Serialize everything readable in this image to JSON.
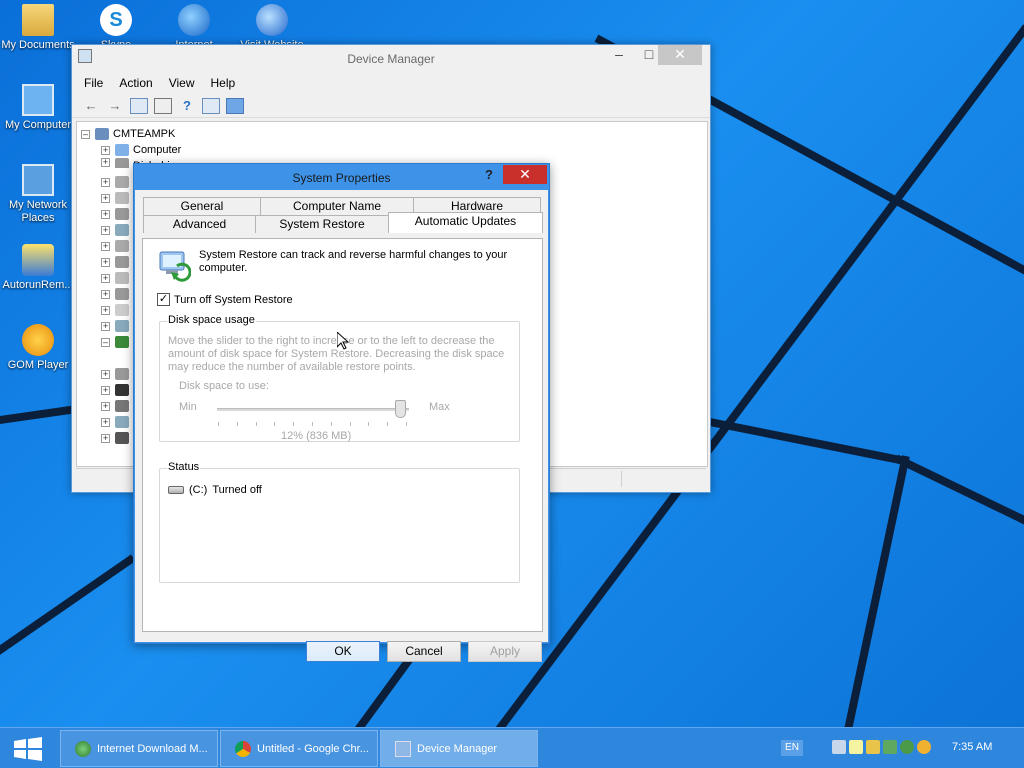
{
  "desktop": {
    "icons": [
      {
        "label": "My Documents"
      },
      {
        "label": "Skype"
      },
      {
        "label": "Internet"
      },
      {
        "label": "Visit Website"
      },
      {
        "label": "My Computer"
      },
      {
        "label": "My Network Places"
      },
      {
        "label": "AutorunRem..."
      },
      {
        "label": "GOM Player"
      }
    ]
  },
  "device_manager": {
    "title": "Device Manager",
    "menu": [
      "File",
      "Action",
      "View",
      "Help"
    ],
    "tree": {
      "root": "CMTEAMPK",
      "items": [
        "Computer",
        "Disk drives"
      ]
    }
  },
  "system_properties": {
    "title": "System Properties",
    "help_glyph": "?",
    "tabs_row1": [
      "General",
      "Computer Name",
      "Hardware"
    ],
    "tabs_row2": [
      "Advanced",
      "System Restore",
      "Automatic Updates"
    ],
    "active_tab": "Automatic Updates",
    "intro_text": "System Restore can track and reverse harmful changes to your computer.",
    "turn_off_label": "Turn off System Restore",
    "turn_off_checked": true,
    "disk_usage": {
      "group_label": "Disk space usage",
      "description": "Move the slider to the right to increase or to the left to decrease the amount of disk space for System Restore. Decreasing the disk space may reduce the number of available restore points.",
      "space_label": "Disk space to use:",
      "min_label": "Min",
      "max_label": "Max",
      "slider_value_text": "12% (836 MB)",
      "slider_percent": 0.96
    },
    "status": {
      "group_label": "Status",
      "drive": "(C:)",
      "state": "Turned off"
    },
    "buttons": {
      "ok": "OK",
      "cancel": "Cancel",
      "apply": "Apply"
    }
  },
  "taskbar": {
    "tasks": [
      {
        "label": "Internet Download M..."
      },
      {
        "label": "Untitled - Google Chr..."
      },
      {
        "label": "Device Manager"
      }
    ],
    "language": "EN",
    "clock": "7:35 AM"
  },
  "colors": {
    "desktop_blue": "#0a6fd8",
    "taskbar": "#2f86dd",
    "close_red": "#c9302c",
    "dialog_frame": "#3e93e8"
  }
}
